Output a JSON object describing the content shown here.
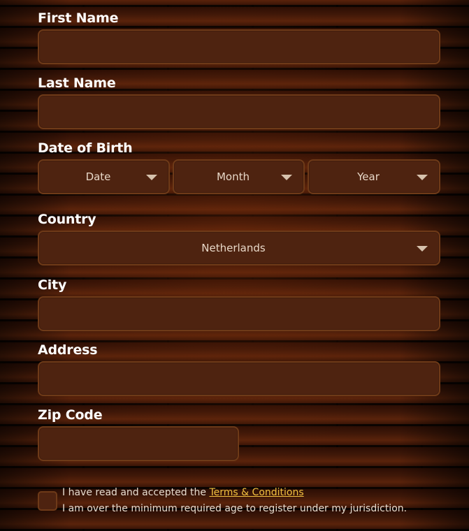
{
  "form": {
    "first_name": {
      "label": "First Name",
      "value": ""
    },
    "last_name": {
      "label": "Last Name",
      "value": ""
    },
    "date_of_birth": {
      "label": "Date of Birth",
      "date_placeholder": "Date",
      "month_placeholder": "Month",
      "year_placeholder": "Year"
    },
    "country": {
      "label": "Country",
      "selected": "Netherlands"
    },
    "city": {
      "label": "City",
      "value": ""
    },
    "address": {
      "label": "Address",
      "value": ""
    },
    "zip_code": {
      "label": "Zip Code",
      "value": ""
    }
  },
  "terms": {
    "checked": false,
    "text_before": "I have read and accepted the ",
    "link_text": "Terms & Conditions",
    "age_text": "I am over the minimum required age to register under my jurisdiction."
  },
  "icons": {
    "dropdown": "chevron-down-icon"
  },
  "colors": {
    "field_bg": "#4e2310",
    "field_border": "#6e3a18",
    "link": "#f2c040",
    "label": "#ffffff"
  }
}
